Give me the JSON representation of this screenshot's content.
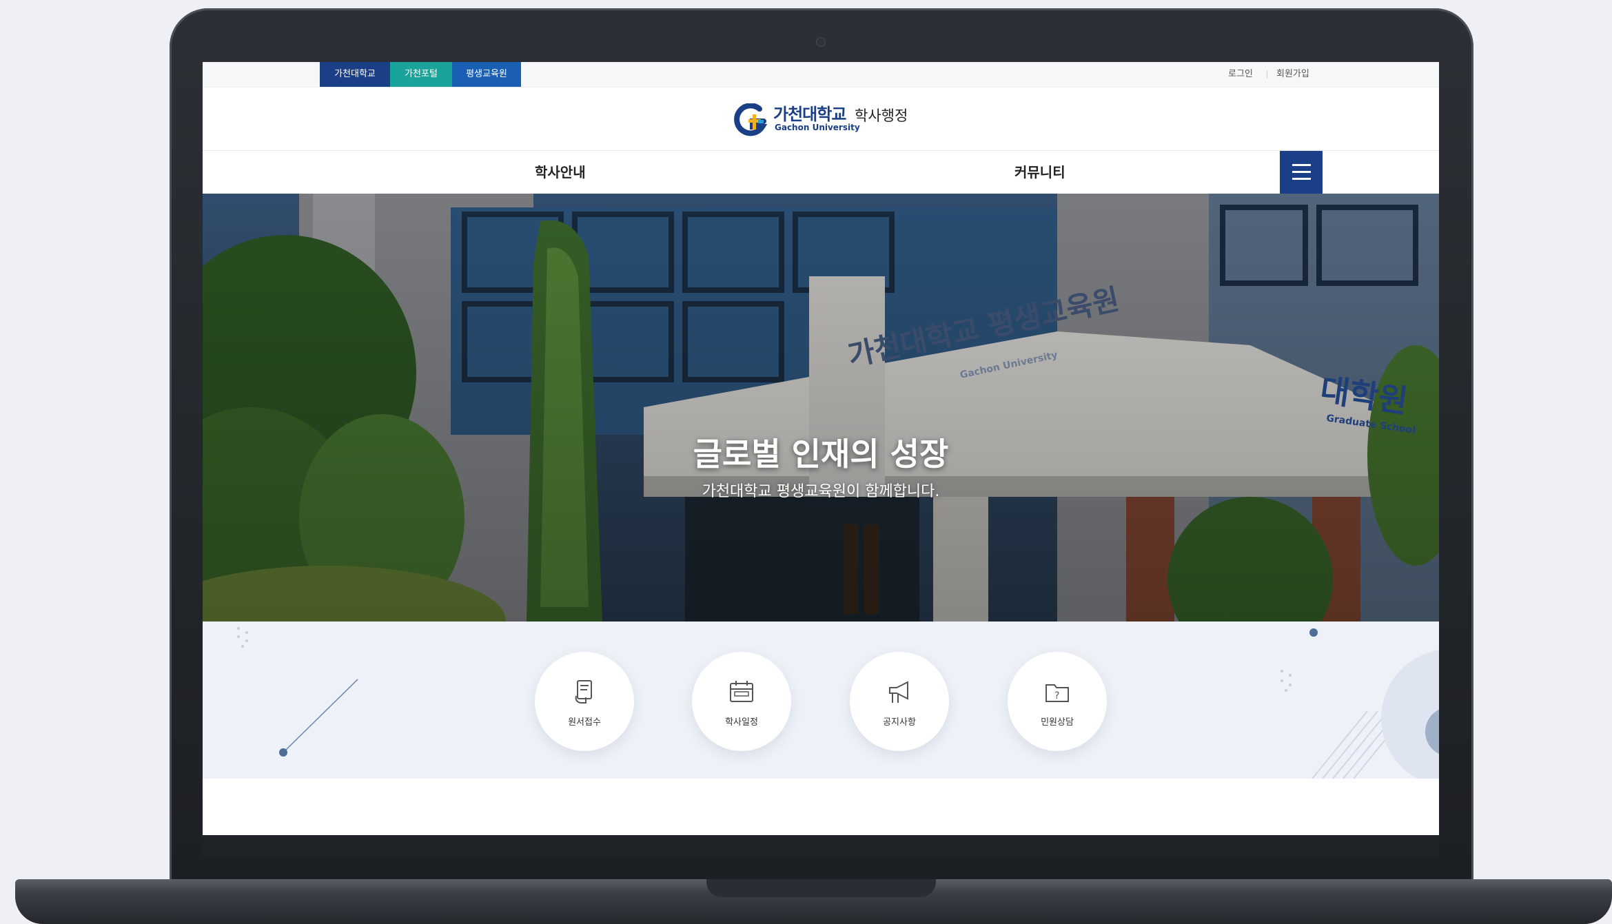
{
  "topbar": {
    "tabs": [
      "가천대학교",
      "가천포털",
      "평생교육원"
    ],
    "login": "로그인",
    "join": "회원가입"
  },
  "logo": {
    "korean": "가천대학교",
    "english": "Gachon University",
    "subtitle": "학사행정"
  },
  "nav": {
    "items": [
      "학사안내",
      "커뮤니티"
    ],
    "menu_icon": "hamburger-icon"
  },
  "hero": {
    "title": "글로벌 인재의 성장",
    "subtitle": "가천대학교 평생교육원이 함께합니다.",
    "sign_text": "가천대학교 평생교육원",
    "sign_english": "Gachon University",
    "grad_sign": "대학원",
    "grad_sign_english": "Graduate School"
  },
  "quick_links": [
    {
      "label": "원서접수",
      "icon": "application-icon"
    },
    {
      "label": "학사일정",
      "icon": "calendar-icon"
    },
    {
      "label": "공지사항",
      "icon": "megaphone-icon"
    },
    {
      "label": "민원상담",
      "icon": "folder-question-icon"
    }
  ],
  "colors": {
    "navy": "#1b3f86",
    "teal": "#1aa39a",
    "blue": "#1b5fb4",
    "quick_bg": "#eef1f7"
  }
}
